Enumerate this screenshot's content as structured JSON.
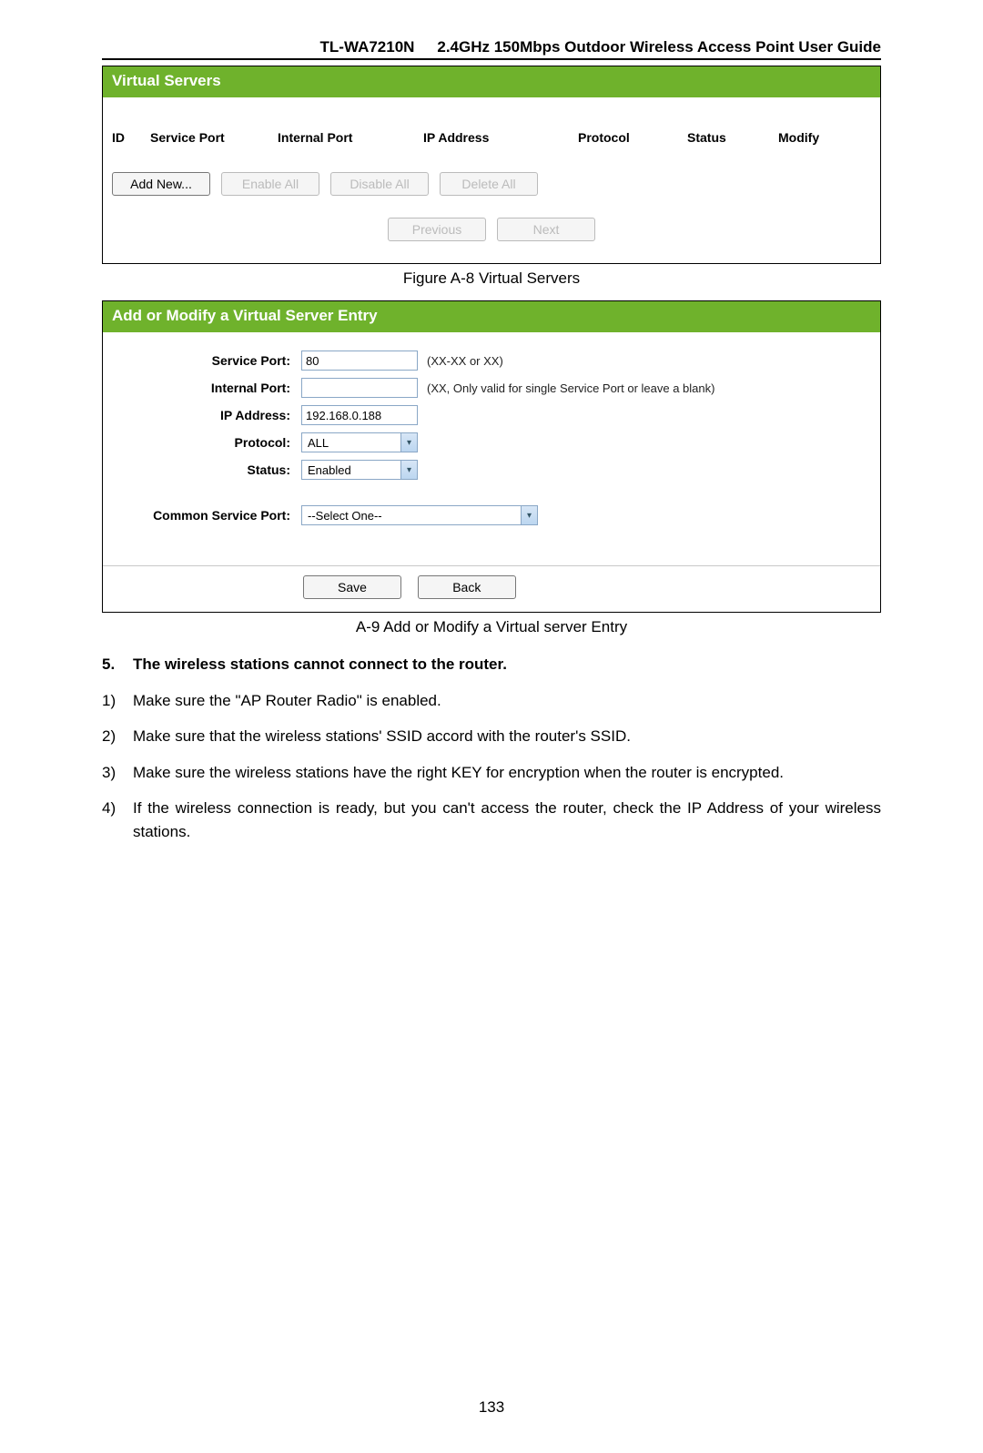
{
  "header": {
    "model": "TL-WA7210N",
    "title": "2.4GHz 150Mbps Outdoor Wireless Access Point User Guide"
  },
  "banner1": "Virtual Servers",
  "vs_cols": {
    "id": "ID",
    "service_port": "Service Port",
    "internal_port": "Internal Port",
    "ip": "IP Address",
    "protocol": "Protocol",
    "status": "Status",
    "modify": "Modify"
  },
  "btns1": {
    "add_new": "Add New...",
    "enable_all": "Enable All",
    "disable_all": "Disable All",
    "delete_all": "Delete All"
  },
  "nav": {
    "prev": "Previous",
    "next": "Next"
  },
  "caption1": "Figure A-8 Virtual Servers",
  "banner2": "Add or Modify a Virtual Server Entry",
  "form": {
    "labels": {
      "service_port": "Service Port:",
      "internal_port": "Internal Port:",
      "ip": "IP Address:",
      "protocol": "Protocol:",
      "status": "Status:",
      "csp": "Common Service Port:"
    },
    "values": {
      "service_port": "80",
      "internal_port": "",
      "ip": "192.168.0.188",
      "protocol": "ALL",
      "status": "Enabled",
      "csp": "--Select One--"
    },
    "hints": {
      "service_port": "(XX-XX or XX)",
      "internal_port": "(XX, Only valid for single Service Port or leave a blank)"
    },
    "btns": {
      "save": "Save",
      "back": "Back"
    }
  },
  "caption2": "A-9 Add or Modify a Virtual server Entry",
  "q5": {
    "num": "5.",
    "text": "The wireless stations cannot connect to the router."
  },
  "steps": {
    "s1": {
      "num": "1)",
      "text": "Make sure the \"AP Router Radio\" is enabled."
    },
    "s2": {
      "num": "2)",
      "text": "Make sure that the wireless stations' SSID accord with the router's SSID."
    },
    "s3": {
      "num": "3)",
      "text": "Make sure the wireless stations have the right KEY for encryption when the router is encrypted."
    },
    "s4": {
      "num": "4)",
      "text": "If the wireless connection is ready, but you can't access the router, check the IP Address of your wireless stations."
    }
  },
  "page_number": "133"
}
